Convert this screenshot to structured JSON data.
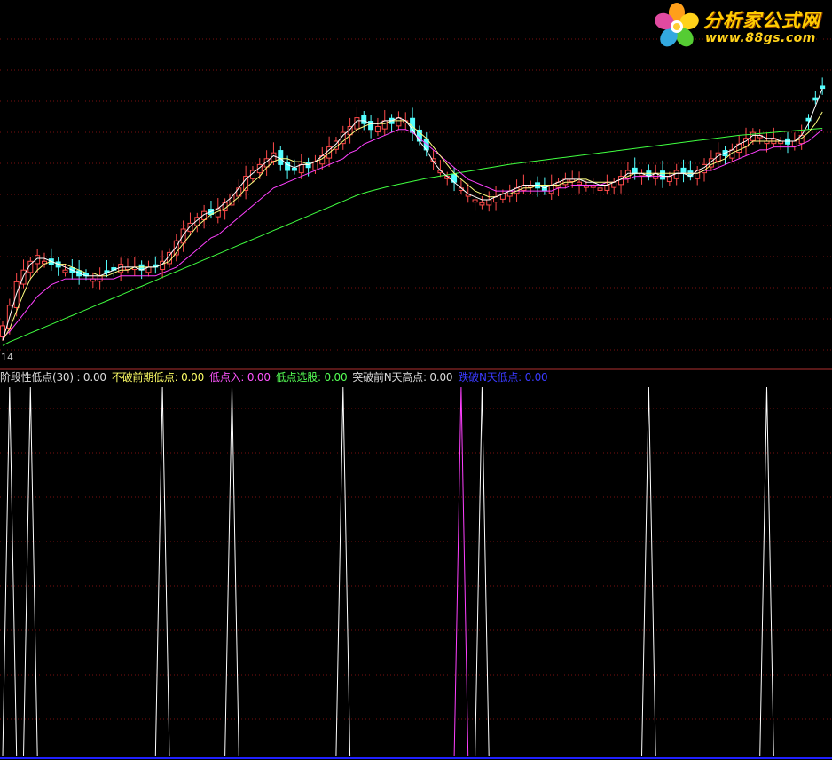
{
  "legend": [
    {
      "label": "阶段性低点(30)",
      "sep": " : ",
      "value": "0.00",
      "color": "#dcdcdc"
    },
    {
      "label": "不破前期低点",
      "sep": ": ",
      "value": "0.00",
      "color": "#ffff66"
    },
    {
      "label": "低点入",
      "sep": ": ",
      "value": "0.00",
      "color": "#ff55ff"
    },
    {
      "label": "低点选股",
      "sep": ": ",
      "value": "0.00",
      "color": "#55ff55"
    },
    {
      "label": "突破前N天高点",
      "sep": ": ",
      "value": "0.00",
      "color": "#dcdcdc"
    },
    {
      "label": "跌破N天低点",
      "sep": ": ",
      "value": "0.00",
      "color": "#3a3aff"
    }
  ],
  "axis_value_label": "14",
  "logo": {
    "title": "分析家公式网",
    "url": "www.88gs.com"
  },
  "colors": {
    "up": "#ff4a4a",
    "down": "#54ffff",
    "ma_short": "#ffffff",
    "ma_mid": "#ffff80",
    "ma_long": "#ff40ff",
    "ma_60": "#40ff40",
    "grid": "#7a1010",
    "divider": "#b03030",
    "bottom_axis": "#2020ff",
    "spike_white": "#ffffff",
    "spike_magenta": "#ff40ff"
  },
  "chart_data": [
    {
      "type": "candlestick",
      "title": "",
      "ylim": [
        0,
        100
      ],
      "grid": true,
      "up_flags": [
        1,
        1,
        1,
        1,
        1,
        1,
        1,
        0,
        0,
        1,
        0,
        0,
        0,
        1,
        1,
        0,
        0,
        1,
        1,
        1,
        0,
        1,
        0,
        1,
        1,
        1,
        1,
        1,
        1,
        1,
        0,
        1,
        1,
        1,
        1,
        1,
        1,
        1,
        1,
        1,
        0,
        0,
        0,
        1,
        0,
        1,
        1,
        1,
        1,
        1,
        1,
        1,
        0,
        0,
        1,
        1,
        0,
        1,
        1,
        0,
        0,
        0,
        1,
        1,
        1,
        0,
        1,
        1,
        1,
        1,
        1,
        1,
        1,
        1,
        1,
        1,
        1,
        0,
        0,
        1,
        1,
        1,
        1,
        1,
        1,
        1,
        1,
        1,
        1,
        1,
        1,
        0,
        1,
        0,
        1,
        0,
        1,
        1,
        0,
        0,
        1,
        1,
        1,
        1,
        0,
        1,
        1,
        1,
        1,
        1,
        1,
        1,
        1,
        0,
        1,
        1
      ],
      "close": [
        7,
        14,
        22,
        26,
        29,
        31,
        29,
        28,
        27,
        26,
        25,
        24,
        24,
        23,
        24,
        25,
        26,
        28,
        27,
        27,
        26,
        27,
        27,
        29,
        32,
        36,
        40,
        42,
        44,
        46,
        45,
        47,
        49,
        52,
        54,
        58,
        60,
        62,
        64,
        66,
        62,
        60,
        60,
        62,
        61,
        63,
        65,
        68,
        70,
        73,
        75,
        78,
        76,
        74,
        75,
        77,
        76,
        78,
        77,
        73,
        70,
        67,
        64,
        60,
        58,
        56,
        54,
        52,
        50,
        49,
        50,
        51,
        52,
        53,
        54,
        55,
        55,
        54,
        53,
        55,
        56,
        57,
        57,
        56,
        55,
        55,
        54,
        55,
        56,
        58,
        60,
        59,
        59,
        58,
        59,
        57,
        58,
        60,
        59,
        58,
        60,
        62,
        64,
        66,
        65,
        67,
        69,
        71,
        73,
        72,
        70,
        71,
        70,
        69,
        70,
        72,
        77,
        84,
        88
      ],
      "ma_short": [
        2,
        10,
        18,
        24,
        28,
        30,
        30,
        29,
        28,
        27,
        26,
        25,
        24,
        24,
        24,
        25,
        26,
        27,
        27,
        27,
        26,
        27,
        27,
        28,
        31,
        34,
        38,
        41,
        43,
        45,
        46,
        47,
        49,
        51,
        54,
        57,
        59,
        61,
        63,
        65,
        64,
        62,
        61,
        62,
        62,
        63,
        65,
        67,
        69,
        72,
        74,
        77,
        77,
        76,
        76,
        77,
        77,
        78,
        77,
        74,
        70,
        67,
        63,
        60,
        58,
        56,
        54,
        52,
        51,
        50,
        50,
        51,
        52,
        53,
        54,
        55,
        55,
        55,
        54,
        55,
        56,
        57,
        57,
        57,
        56,
        56,
        55,
        55,
        56,
        57,
        59,
        59,
        59,
        58,
        59,
        58,
        58,
        59,
        59,
        58,
        60,
        61,
        63,
        65,
        66,
        67,
        69,
        70,
        72,
        72,
        71,
        71,
        70,
        70,
        70,
        72,
        76,
        82,
        88
      ],
      "ma_mid": [
        2,
        6,
        12,
        18,
        23,
        26,
        28,
        29,
        28,
        28,
        27,
        26,
        25,
        25,
        24,
        24,
        25,
        26,
        26,
        27,
        27,
        27,
        27,
        28,
        29,
        32,
        35,
        38,
        41,
        43,
        45,
        46,
        47,
        49,
        51,
        54,
        56,
        58,
        61,
        63,
        64,
        64,
        63,
        63,
        62,
        63,
        64,
        66,
        68,
        70,
        72,
        74,
        75,
        76,
        76,
        76,
        77,
        77,
        77,
        75,
        73,
        71,
        68,
        65,
        62,
        59,
        57,
        55,
        53,
        52,
        51,
        51,
        52,
        52,
        53,
        54,
        54,
        55,
        55,
        55,
        55,
        56,
        56,
        57,
        57,
        56,
        56,
        56,
        56,
        57,
        58,
        59,
        59,
        59,
        59,
        59,
        59,
        59,
        59,
        59,
        59,
        60,
        62,
        63,
        64,
        66,
        67,
        68,
        70,
        70,
        70,
        70,
        70,
        70,
        70,
        71,
        73,
        76,
        80
      ],
      "ma_long": [
        3,
        5,
        8,
        11,
        14,
        17,
        19,
        21,
        22,
        23,
        23,
        23,
        23,
        23,
        23,
        23,
        23,
        24,
        24,
        24,
        24,
        24,
        24,
        25,
        26,
        27,
        29,
        31,
        33,
        35,
        37,
        38,
        40,
        42,
        44,
        46,
        48,
        50,
        52,
        54,
        55,
        56,
        57,
        58,
        59,
        60,
        61,
        62,
        63,
        64,
        66,
        67,
        69,
        70,
        71,
        72,
        73,
        74,
        74,
        73,
        71,
        69,
        67,
        65,
        63,
        61,
        59,
        57,
        56,
        55,
        54,
        53,
        53,
        53,
        53,
        53,
        53,
        53,
        53,
        53,
        54,
        54,
        55,
        55,
        55,
        55,
        55,
        56,
        56,
        57,
        57,
        58,
        58,
        58,
        58,
        58,
        58,
        59,
        59,
        59,
        59,
        60,
        60,
        61,
        62,
        63,
        64,
        65,
        66,
        67,
        67,
        68,
        68,
        68,
        68,
        69,
        70,
        72,
        74
      ],
      "ma_60": [
        0.2,
        1.5,
        2.5,
        3.5,
        4.5,
        5.5,
        6.5,
        7.5,
        8.5,
        9.5,
        10.5,
        11.5,
        12.5,
        13.5,
        14.5,
        15.5,
        16.5,
        17.5,
        18.5,
        19.5,
        20.5,
        21.5,
        22.5,
        23.5,
        24.5,
        25.5,
        26.5,
        27.5,
        28.5,
        29.5,
        30.5,
        31.5,
        32.5,
        33.5,
        34.5,
        35.5,
        36.5,
        37.5,
        38.5,
        39.5,
        40.5,
        41.5,
        42.5,
        43.5,
        44.5,
        45.5,
        46.5,
        47.5,
        48.5,
        49.5,
        50.5,
        51.5,
        52.3,
        53,
        53.6,
        54.2,
        54.8,
        55.3,
        55.8,
        56.3,
        56.8,
        57.3,
        57.7,
        58.1,
        58.5,
        58.9,
        59.3,
        59.7,
        60.1,
        60.5,
        60.9,
        61.3,
        61.7,
        62.1,
        62.4,
        62.7,
        63,
        63.3,
        63.6,
        63.9,
        64.2,
        64.5,
        64.8,
        65.1,
        65.4,
        65.7,
        66,
        66.3,
        66.6,
        66.9,
        67.2,
        67.5,
        67.8,
        68.1,
        68.4,
        68.7,
        69,
        69.3,
        69.6,
        69.9,
        70.2,
        70.5,
        70.8,
        71.1,
        71.4,
        71.7,
        72,
        72.2,
        72.4,
        72.6,
        72.8,
        73,
        73.2,
        73.4,
        73.6,
        73.8,
        74,
        74.2,
        74.4
      ]
    },
    {
      "type": "line",
      "title": "",
      "ylim": [
        0,
        1
      ],
      "series": [
        {
          "color_key": "spike_white",
          "spike_x": [
            1,
            4,
            23,
            33,
            49,
            69,
            93,
            110
          ]
        },
        {
          "color_key": "spike_magenta",
          "spike_x": [
            66
          ]
        }
      ]
    }
  ]
}
